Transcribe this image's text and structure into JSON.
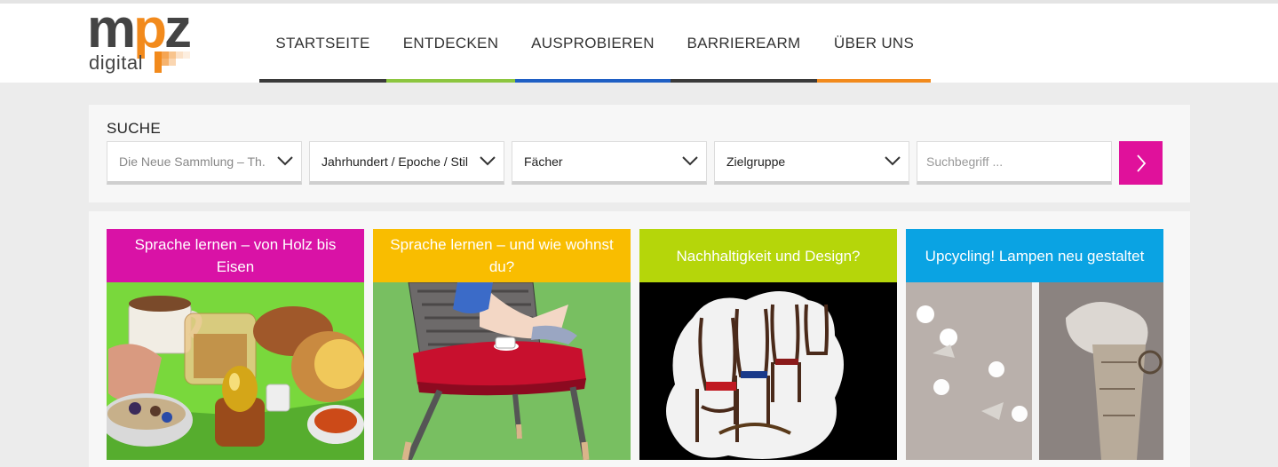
{
  "brand": {
    "logo_main": "mpz",
    "logo_sub": "digital"
  },
  "nav": [
    {
      "label": "STARTSEITE",
      "color": "#3a3a3a"
    },
    {
      "label": "ENTDECKEN",
      "color": "#8cc63f"
    },
    {
      "label": "AUSPROBIEREN",
      "color": "#1f5fc4"
    },
    {
      "label": "BARRIEREARM",
      "color": "#3a3a3a"
    },
    {
      "label": "ÜBER UNS",
      "color": "#f28a1c"
    }
  ],
  "search": {
    "title": "SUCHE",
    "filters": [
      {
        "value": "Die Neue Sammlung – Th...",
        "is_placeholder": true
      },
      {
        "value": "Jahrhundert / Epoche / Stil",
        "is_placeholder": false
      },
      {
        "value": "Fächer",
        "is_placeholder": false
      },
      {
        "value": "Zielgruppe",
        "is_placeholder": false
      }
    ],
    "input_placeholder": "Suchbegriff ...",
    "input_value": "",
    "button_color": "#e0119b"
  },
  "cards": [
    {
      "title": "Sprache lernen – von Holz bis Eisen",
      "color": "#d912a6",
      "image": "breakfast-still-life"
    },
    {
      "title": "Sprache lernen – und wie wohnst du?",
      "color": "#f9bd00",
      "image": "person-on-red-chair"
    },
    {
      "title": "Nachhaltigkeit und Design?",
      "color": "#b5d60a",
      "image": "bentwood-chairs"
    },
    {
      "title": "Upcycling! Lampen neu gestaltet",
      "color": "#0aa3e3",
      "image": "paper-lamps"
    }
  ]
}
